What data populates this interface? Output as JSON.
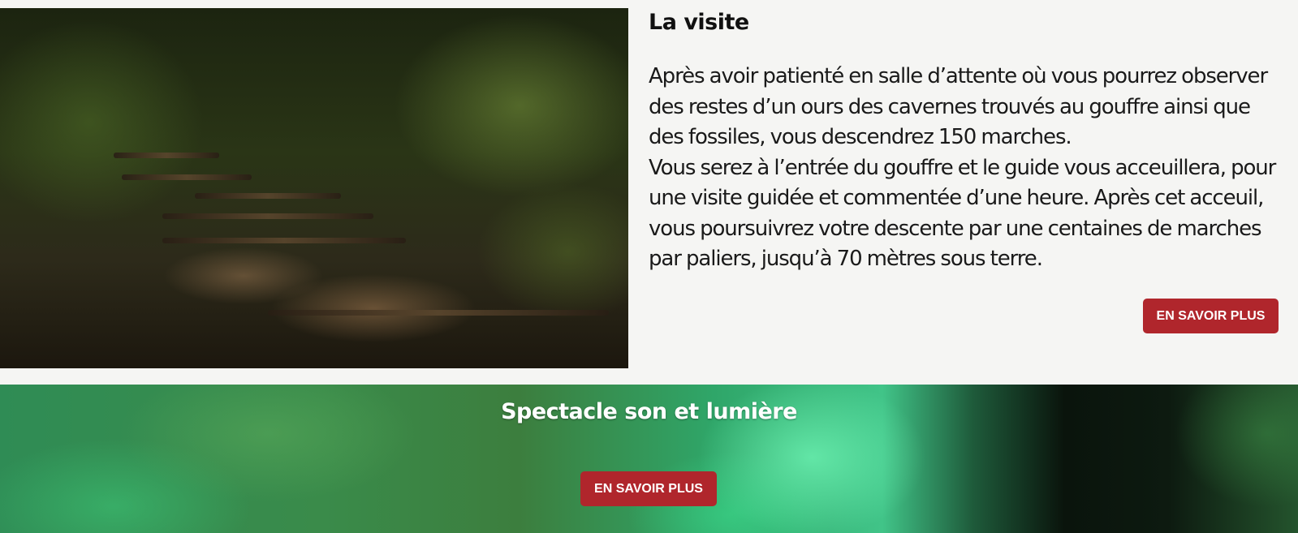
{
  "visit": {
    "title": "La visite",
    "paragraph_1": "Après avoir patienté en salle d’attente où vous pourrez observer des restes d’un ours des cavernes trouvés au gouffre ainsi que des fossiles, vous descendrez 150 marches.",
    "paragraph_2": "Vous serez à l’entrée du gouffre et le guide vous acceuillera, pour une visite guidée et commentée d’une heure. Après cet acceuil, vous poursuivrez votre descente par une centaines de marches par paliers, jusqu’à 70 mètres sous terre.",
    "button_label": "EN SAVOIR PLUS"
  },
  "spectacle": {
    "title": "Spectacle son et lumière",
    "button_label": "EN SAVOIR PLUS"
  },
  "colors": {
    "accent_button": "#b0262c",
    "page_background": "#f5f5f3"
  }
}
